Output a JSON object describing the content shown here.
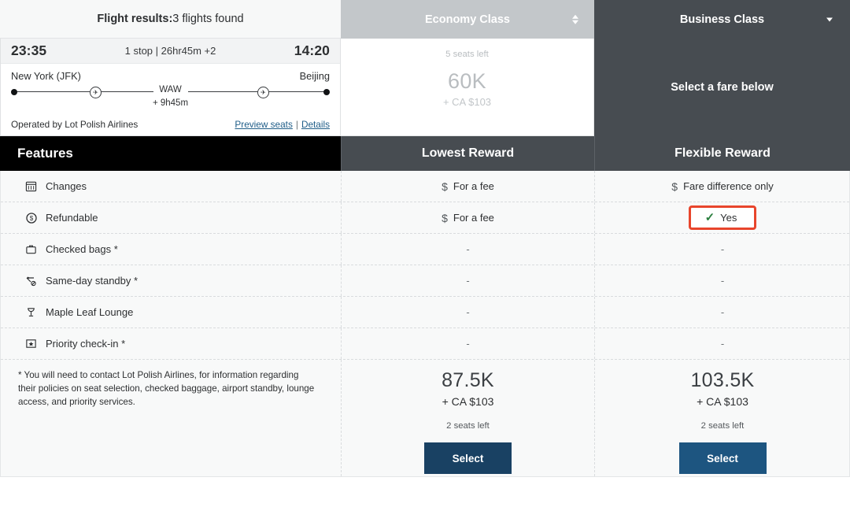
{
  "header": {
    "results_label": "Flight results:",
    "results_value": "3 flights found",
    "tabs": [
      {
        "label": "Economy Class",
        "icon": "updown-chevron-icon"
      },
      {
        "label": "Business Class",
        "icon": "chevron-down-icon"
      }
    ]
  },
  "flight": {
    "depart_time": "23:35",
    "summary": "1 stop | 26hr45m +2",
    "arrive_time": "14:20",
    "origin": "New York (JFK)",
    "destination": "Beijing",
    "stop_code": "WAW",
    "layover": "+ 9h45m",
    "operated_by": "Operated by Lot Polish Airlines",
    "preview_seats": "Preview seats",
    "separator": "|",
    "details": "Details"
  },
  "fare_panels": {
    "economy": {
      "seats_left": "5 seats left",
      "miles": "60K",
      "cash": "+ CA $103"
    },
    "business": {
      "prompt": "Select a fare below"
    }
  },
  "table": {
    "features_header": "Features",
    "columns": [
      "Lowest Reward",
      "Flexible Reward"
    ],
    "rows": [
      {
        "icon": "calendar-icon",
        "label": "Changes",
        "lowest": {
          "money_icon": "$",
          "text": "For a fee"
        },
        "flexible": {
          "money_icon": "$",
          "text": "Fare difference only"
        }
      },
      {
        "icon": "refund-dollar-circle-icon",
        "label": "Refundable",
        "lowest": {
          "money_icon": "$",
          "text": "For a fee"
        },
        "flexible": {
          "check_icon": "✓",
          "text": "Yes",
          "highlighted": true
        }
      },
      {
        "icon": "checked-bag-icon",
        "label": "Checked bags *",
        "lowest": {
          "text": "-"
        },
        "flexible": {
          "text": "-"
        }
      },
      {
        "icon": "same-day-standby-icon",
        "label": "Same-day standby *",
        "lowest": {
          "text": "-"
        },
        "flexible": {
          "text": "-"
        }
      },
      {
        "icon": "lounge-glass-icon",
        "label": "Maple Leaf Lounge",
        "lowest": {
          "text": "-"
        },
        "flexible": {
          "text": "-"
        }
      },
      {
        "icon": "priority-star-icon",
        "label": "Priority check-in *",
        "lowest": {
          "text": "-"
        },
        "flexible": {
          "text": "-"
        }
      }
    ]
  },
  "footer": {
    "note": "* You will need to contact Lot Polish Airlines, for information regarding their policies on seat selection, checked baggage, airport standby, lounge access, and priority services.",
    "columns": [
      {
        "miles": "87.5K",
        "cash": "+ CA $103",
        "seats_left": "2 seats left",
        "button": "Select"
      },
      {
        "miles": "103.5K",
        "cash": "+ CA $103",
        "seats_left": "2 seats left",
        "button": "Select"
      }
    ]
  },
  "colors": {
    "highlight_border": "#e8452c",
    "check_green": "#2a7f3e",
    "header_dark": "#474c51",
    "features_black": "#000000",
    "button_dark": "#194163",
    "button_mid": "#1d5580",
    "link_blue": "#1f5d88"
  }
}
